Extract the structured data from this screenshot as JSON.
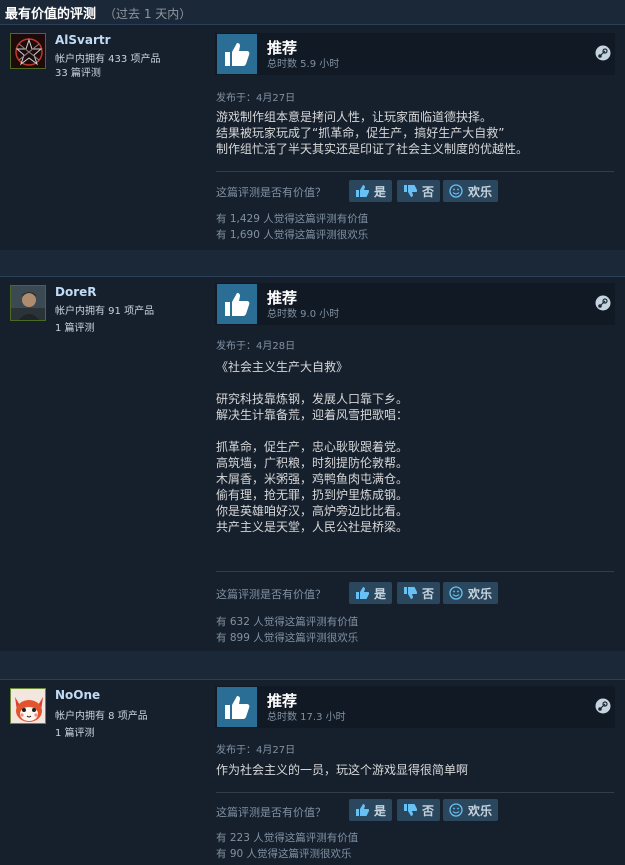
{
  "header": {
    "title": "最有价值的评测",
    "subtitle": "（过去 1 天内）"
  },
  "reviews": [
    {
      "author": "AlSvartr",
      "products": "帐户内拥有 433 项产品",
      "review_count": "33 篇评测",
      "recommend": "推荐",
      "hours": "总时数 5.9 小时",
      "posted": "发布于：4月27日",
      "content": "游戏制作组本意是拷问人性，让玩家面临道德抉择。\n结果被玩家玩成了“抓革命，促生产，搞好生产大自救”\n制作组忙活了半天其实还是印证了社会主义制度的优越性。",
      "question": "这篇评测是否有价值？",
      "yes": "是",
      "no": "否",
      "funny": "欢乐",
      "helpful": "有 1,429 人觉得这篇评测有价值",
      "funny_count": "有 1,690 人觉得这篇评测很欢乐"
    },
    {
      "author": "DoreR",
      "products": "帐户内拥有 91 项产品",
      "review_count": "1 篇评测",
      "recommend": "推荐",
      "hours": "总时数 9.0 小时",
      "posted": "发布于：4月28日",
      "content": "《社会主义生产大自救》\n\n研究科技靠炼钢，发展人口靠下乡。\n解决生计靠备荒，迎着风雪把歌唱：\n\n抓革命，促生产，忠心耿耿跟着党。\n高筑墙，广积粮，时刻提防伦敦帮。\n木屑香，米粥强，鸡鸭鱼肉屯满仓。\n偷有理，抢无罪，扔到炉里炼成钢。\n你是英雄咱好汉，高炉旁边比比看。\n共产主义是天堂，人民公社是桥梁。",
      "question": "这篇评测是否有价值？",
      "yes": "是",
      "no": "否",
      "funny": "欢乐",
      "helpful": "有 632 人觉得这篇评测有价值",
      "funny_count": "有 899 人觉得这篇评测很欢乐"
    },
    {
      "author": "NoOne",
      "products": "帐户内拥有 8 项产品",
      "review_count": "1 篇评测",
      "recommend": "推荐",
      "hours": "总时数 17.3 小时",
      "posted": "发布于：4月27日",
      "content": "作为社会主义的一员，玩这个游戏显得很简单啊",
      "question": "这篇评测是否有价值？",
      "yes": "是",
      "no": "否",
      "funny": "欢乐",
      "helpful": "有 223 人觉得这篇评测有价值",
      "funny_count": "有 90 人觉得这篇评测很欢乐"
    }
  ]
}
